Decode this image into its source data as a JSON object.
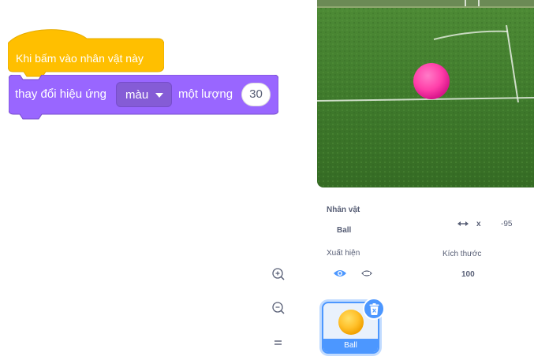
{
  "code": {
    "hat_block_label": "Khi bấm vào nhân vật này",
    "block_prefix": "thay đổi hiệu ứng",
    "effect_dropdown_value": "màu",
    "block_middle": "một lượng",
    "amount_value": "30",
    "hat_color": "#ffbf00",
    "looks_color": "#9966ff"
  },
  "zoom": {
    "zoom_in_icon": "zoom-in-icon",
    "zoom_out_icon": "zoom-out-icon",
    "reset_icon": "equals-icon"
  },
  "sprite_info": {
    "sprite_label": "Nhân vật",
    "sprite_name": "Ball",
    "x_label": "x",
    "x_value": "-95",
    "show_label": "Xuất hiện",
    "size_label": "Kích thước",
    "size_value": "100"
  },
  "sprite_list": {
    "selected_sprite_name": "Ball",
    "accent_color": "#4c97ff"
  },
  "stage": {
    "ball_color": "#ff3fa9",
    "grass_color": "#3d7a2a"
  }
}
